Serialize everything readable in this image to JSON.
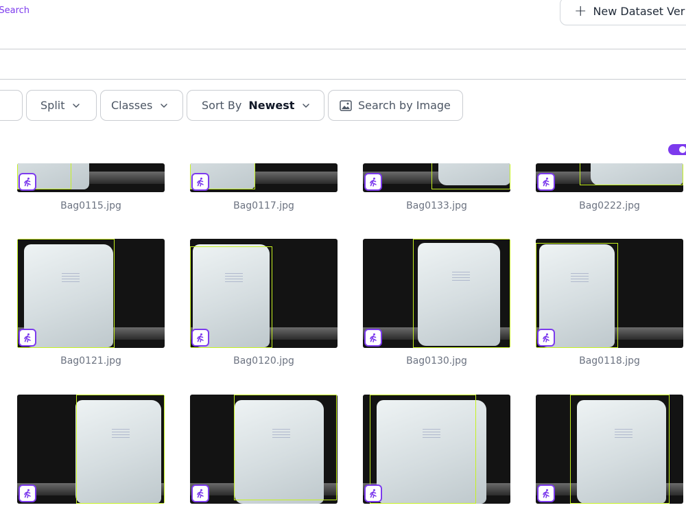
{
  "header": {
    "help_link": "p Search",
    "new_version_button": "New Dataset Ver"
  },
  "filters": {
    "split_label": "Split",
    "classes_label": "Classes",
    "sort_prefix": "Sort By",
    "sort_value": "Newest",
    "search_by_image_label": "Search by Image"
  },
  "toggle": {
    "state": "on"
  },
  "colors": {
    "accent": "#7c3aed",
    "bbox": "#c6f21f"
  },
  "images": [
    {
      "filename": "Bag0115.jpg",
      "badge_icon": "running-person-icon"
    },
    {
      "filename": "Bag0117.jpg",
      "badge_icon": "running-person-icon"
    },
    {
      "filename": "Bag0133.jpg",
      "badge_icon": "running-person-icon"
    },
    {
      "filename": "Bag0222.jpg",
      "badge_icon": "running-person-icon"
    },
    {
      "filename": "Bag0121.jpg",
      "badge_icon": "running-person-icon"
    },
    {
      "filename": "Bag0120.jpg",
      "badge_icon": "running-person-icon"
    },
    {
      "filename": "Bag0130.jpg",
      "badge_icon": "running-person-icon"
    },
    {
      "filename": "Bag0118.jpg",
      "badge_icon": "running-person-icon"
    },
    {
      "filename": "",
      "badge_icon": "running-person-icon"
    },
    {
      "filename": "",
      "badge_icon": "running-person-icon"
    },
    {
      "filename": "",
      "badge_icon": "running-person-icon"
    },
    {
      "filename": "",
      "badge_icon": "running-person-icon"
    }
  ]
}
